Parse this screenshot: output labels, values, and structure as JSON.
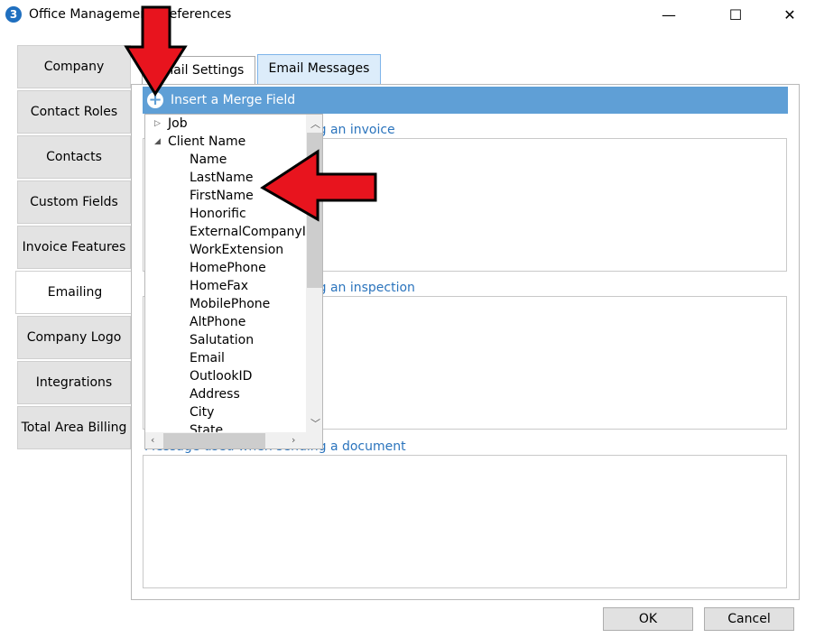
{
  "window": {
    "title": "Office Management Preferences",
    "app_icon": "3",
    "min": "—",
    "max": "☐",
    "close": "✕"
  },
  "nav": {
    "items": [
      {
        "label": "Company"
      },
      {
        "label": "Contact Roles"
      },
      {
        "label": "Contacts"
      },
      {
        "label": "Custom Fields"
      },
      {
        "label": "Invoice Features"
      },
      {
        "label": "Emailing"
      },
      {
        "label": "Company Logo"
      },
      {
        "label": "Integrations"
      },
      {
        "label": "Total Area Billing"
      }
    ],
    "active": "Emailing"
  },
  "tabs": [
    {
      "label": "Email Settings"
    },
    {
      "label": "Email Messages"
    }
  ],
  "merge_bar": {
    "label": "Insert a Merge Field"
  },
  "sections": [
    {
      "label": "Message used when sending an invoice"
    },
    {
      "label": "Message used when sending an inspection"
    },
    {
      "label": "Message used when sending a document"
    }
  ],
  "tree": {
    "job": "Job",
    "client_name": "Client Name",
    "children": [
      "Name",
      "LastName",
      "FirstName",
      "Honorific",
      "ExternalCompanyID",
      "WorkExtension",
      "HomePhone",
      "HomeFax",
      "MobilePhone",
      "AltPhone",
      "Salutation",
      "Email",
      "OutlookID",
      "Address",
      "City",
      "State"
    ]
  },
  "buttons": {
    "ok": "OK",
    "cancel": "Cancel"
  },
  "colors": {
    "accent": "#5f9fd6",
    "arrow": "#e8141e",
    "link": "#2b74bd"
  }
}
